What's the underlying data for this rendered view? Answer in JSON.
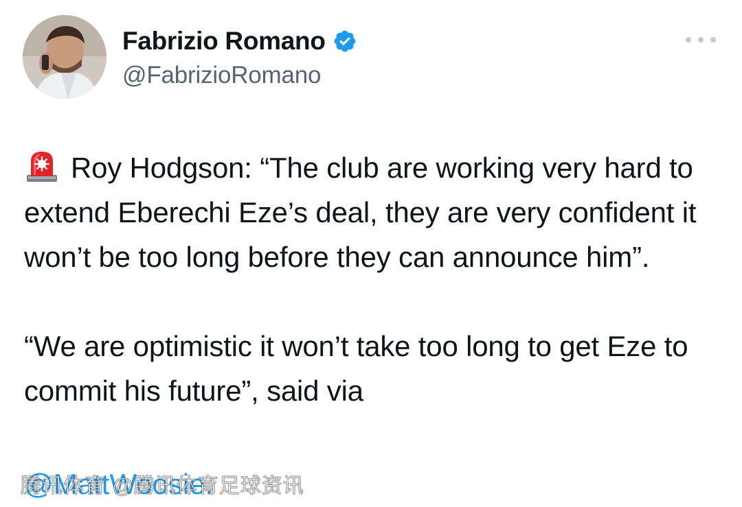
{
  "author": {
    "display_name": "Fabrizio Romano",
    "handle": "@FabrizioRomano",
    "verified_icon": "verified-badge-icon"
  },
  "menu": {
    "icon": "more-options-icon"
  },
  "tweet": {
    "siren_icon": "police-siren-icon",
    "paragraph_1": "Roy Hodgson: “The club are working very hard to extend Eberechi Eze’s deal, they are very confident it won’t be too long before they can announce him”.",
    "paragraph_2_text": "“We are optimistic it won’t take too long to get Eze to commit his future”, said via",
    "mention": "@MattWoosie."
  },
  "watermark": {
    "text": "腾讯体育 @腾讯体育足球资讯"
  },
  "colors": {
    "link": "#1d9bf0",
    "secondary_text": "#536471",
    "verified": "#1d9bf0"
  }
}
